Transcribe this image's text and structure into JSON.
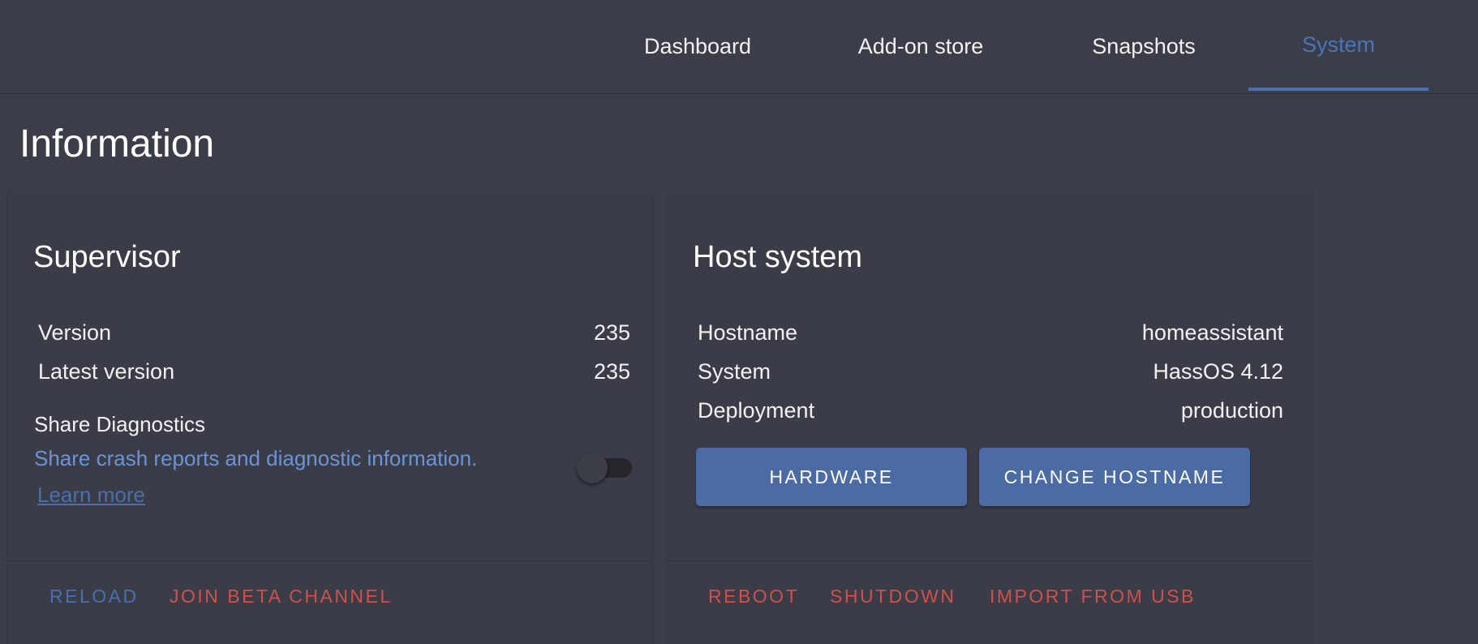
{
  "tabs": [
    {
      "label": "Dashboard"
    },
    {
      "label": "Add-on store"
    },
    {
      "label": "Snapshots"
    },
    {
      "label": "System"
    }
  ],
  "page_title": "Information",
  "supervisor": {
    "title": "Supervisor",
    "rows": [
      {
        "label": "Version",
        "value": "235"
      },
      {
        "label": "Latest version",
        "value": "235"
      }
    ],
    "diagnostics": {
      "title": "Share Diagnostics",
      "description": "Share crash reports and diagnostic information.",
      "learn_more": "Learn more",
      "enabled": false
    },
    "actions": {
      "reload": "RELOAD",
      "join_beta": "JOIN BETA CHANNEL"
    }
  },
  "host": {
    "title": "Host system",
    "rows": [
      {
        "label": "Hostname",
        "value": "homeassistant"
      },
      {
        "label": "System",
        "value": "HassOS 4.12"
      },
      {
        "label": "Deployment",
        "value": "production"
      }
    ],
    "buttons": {
      "hardware": "HARDWARE",
      "change_hostname": "CHANGE HOSTNAME"
    },
    "actions": {
      "reboot": "REBOOT",
      "shutdown": "SHUTDOWN",
      "import_usb": "IMPORT FROM USB"
    }
  },
  "colors": {
    "background": "#3b3d48",
    "accent": "#4a6fad",
    "danger": "#d0504a",
    "link": "#6b94d6"
  }
}
